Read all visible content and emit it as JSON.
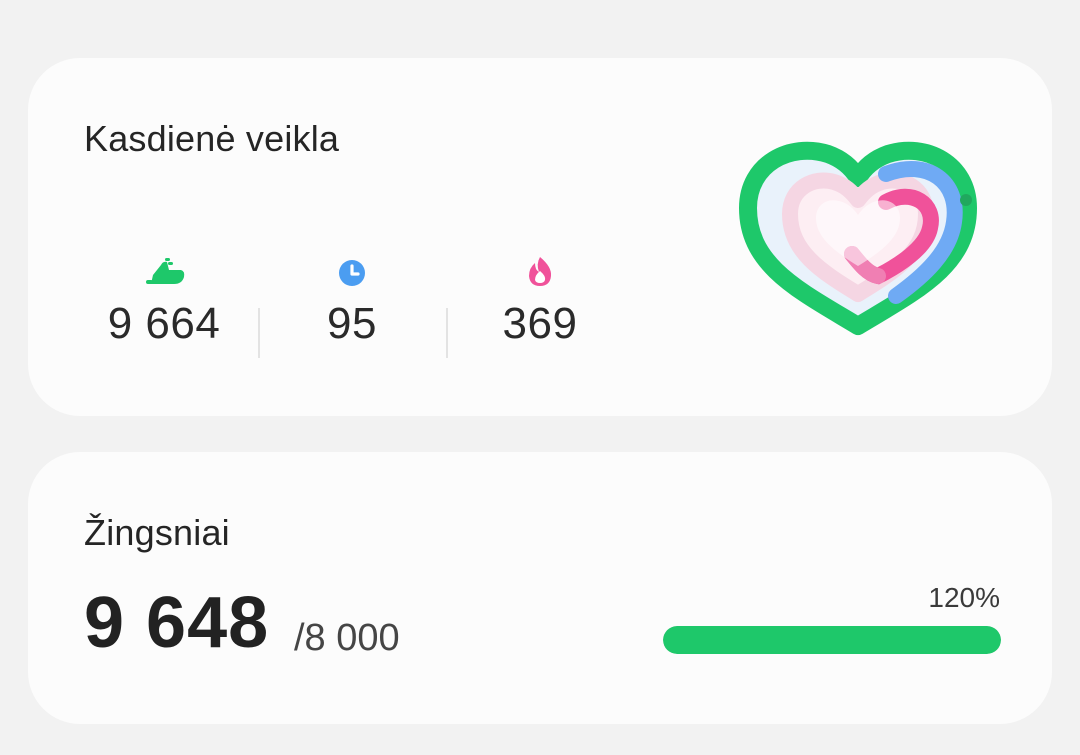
{
  "daily_activity": {
    "title": "Kasdienė veikla",
    "steps": "9 664",
    "active_minutes": "95",
    "calories": "369",
    "colors": {
      "steps": "#1ec86a",
      "minutes": "#4b9df1",
      "calories": "#f0529a"
    },
    "icons": [
      "shoe-icon",
      "clock-icon",
      "flame-icon",
      "activity-heart-icon"
    ]
  },
  "steps_card": {
    "title": "Žingsniai",
    "count": "9 648",
    "goal": "/8 000",
    "percent_label": "120%",
    "progress_fraction": 1.0,
    "bar_color": "#1ec86a"
  }
}
